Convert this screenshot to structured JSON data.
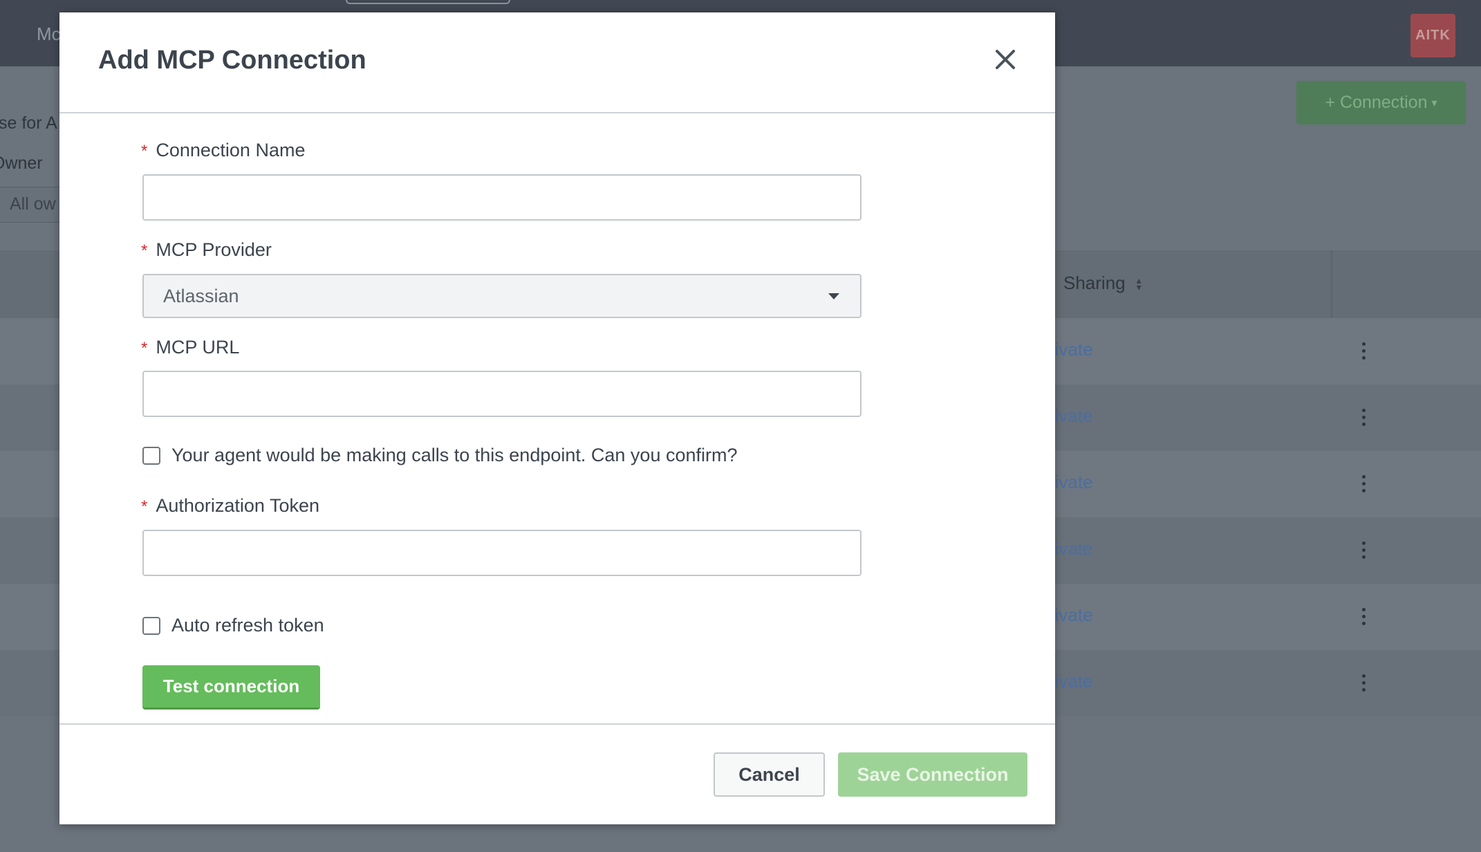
{
  "background": {
    "app_title": "Mc",
    "avatar_initials": "AITK",
    "add_connection_button": "+ Connection",
    "filter_label_partial": "se for A",
    "owner_label_partial": "Owner",
    "owner_select_partial": "All ow",
    "table": {
      "sharing_header": "Sharing",
      "rows": [
        {
          "sharing": "rivate"
        },
        {
          "sharing": "rivate"
        },
        {
          "sharing": "rivate"
        },
        {
          "sharing": "rivate"
        },
        {
          "sharing": "rivate"
        },
        {
          "sharing": "rivate"
        }
      ]
    }
  },
  "modal": {
    "title": "Add MCP Connection",
    "fields": {
      "connection_name": {
        "label": "Connection Name",
        "required_mark": "*",
        "value": ""
      },
      "mcp_provider": {
        "label": "MCP Provider",
        "required_mark": "*",
        "selected": "Atlassian"
      },
      "mcp_url": {
        "label": "MCP URL",
        "required_mark": "*",
        "value": ""
      },
      "confirm_checkbox": {
        "label": "Your agent would be making calls to this endpoint. Can you confirm?",
        "checked": false
      },
      "authorization_token": {
        "label": "Authorization Token",
        "required_mark": "*",
        "value": ""
      },
      "auto_refresh_checkbox": {
        "label": "Auto refresh token",
        "checked": false
      }
    },
    "test_button": "Test connection",
    "footer": {
      "cancel": "Cancel",
      "save": "Save Connection"
    }
  },
  "colors": {
    "primary_green": "#65bc5c",
    "disabled_green": "#9ed397",
    "required_red": "#d4292f",
    "link_blue": "#4b6ea1"
  }
}
